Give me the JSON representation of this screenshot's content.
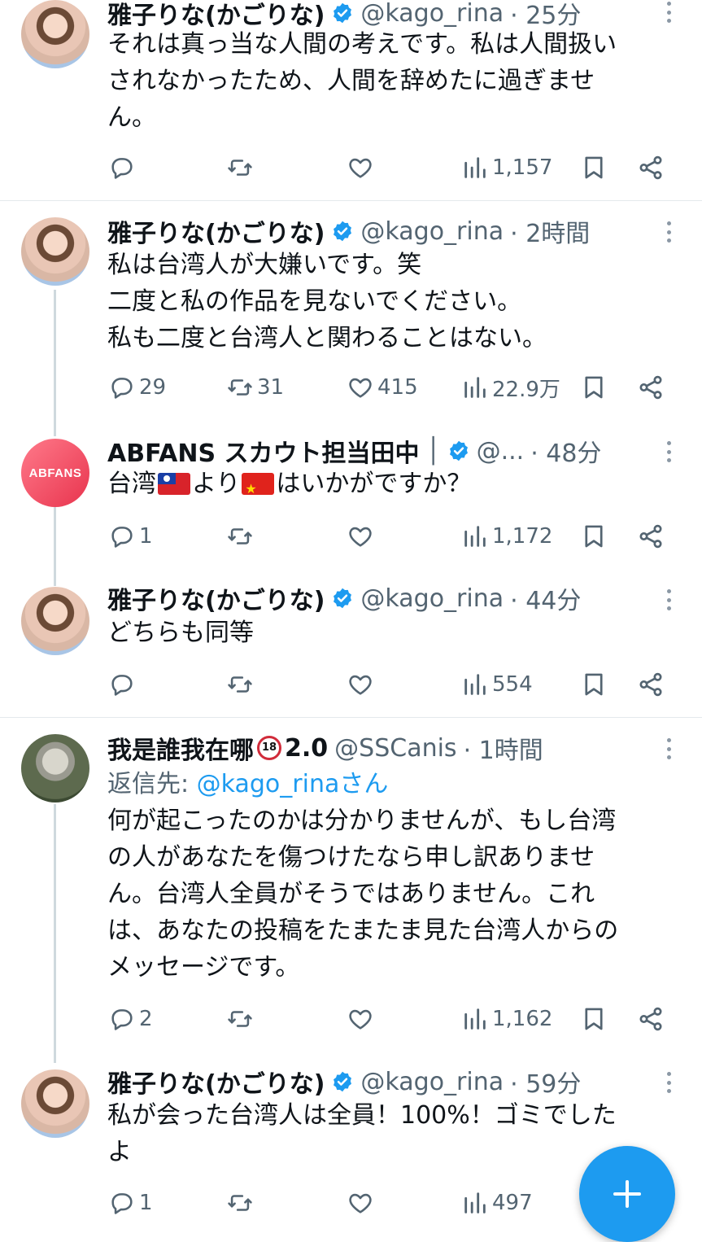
{
  "colors": {
    "accent": "#1d9bf0",
    "text": "#0f1419",
    "muted": "#536471",
    "divider": "#e4e9ec",
    "thread": "#cfd9de"
  },
  "tweets": [
    {
      "name": "雅子りな(かごりな)",
      "handle": "@kago_rina",
      "time": "· 25分",
      "lines": [
        "それは真っ当な人間の考えです。私は人間扱い",
        "されなかったため、人間を辞めたに過ぎませ",
        "ん。"
      ],
      "replies": "",
      "retweets": "",
      "likes": "",
      "views": "1,157"
    },
    {
      "name": "雅子りな(かごりな)",
      "handle": "@kago_rina",
      "time": "· 2時間",
      "lines": [
        "私は台湾人が大嫌いです。笑",
        "二度と私の作品を見ないでください。",
        "私も二度と台湾人と関わることはない。"
      ],
      "replies": "29",
      "retweets": "31",
      "likes": "415",
      "views": "22.9万"
    },
    {
      "name": "ABFANS スカウト担当田中",
      "name_suffix": "│",
      "handle": "@...",
      "time": "· 48分",
      "avatar_text": "ABFANS",
      "text_part1": "台湾",
      "text_part2": "より",
      "text_part3": "はいかがですか？",
      "replies": "1",
      "retweets": "",
      "likes": "",
      "views": "1,172"
    },
    {
      "name": "雅子りな(かごりな)",
      "handle": "@kago_rina",
      "time": "· 44分",
      "lines": [
        "どちらも同等"
      ],
      "replies": "",
      "retweets": "",
      "likes": "",
      "views": "554"
    },
    {
      "name": "我是誰我在哪",
      "badge": "18",
      "name_suffix": "2.0",
      "handle": "@SSCanis",
      "time": "· 1時間",
      "reply_label": "返信先: ",
      "reply_mention": "@kago_rinaさん",
      "lines": [
        "何が起こったのかは分かりませんが、もし台湾",
        "の人があなたを傷つけたなら申し訳ありませ",
        "ん。台湾人全員がそうではありません。これ",
        "は、あなたの投稿をたまたま見た台湾人からの",
        "メッセージです。"
      ],
      "replies": "2",
      "retweets": "",
      "likes": "",
      "views": "1,162"
    },
    {
      "name": "雅子りな(かごりな)",
      "handle": "@kago_rina",
      "time": "· 59分",
      "lines": [
        "私が会った台湾人は全員！100%！ゴミでした",
        "よ"
      ],
      "replies": "1",
      "retweets": "",
      "likes": "",
      "views": "497"
    }
  ],
  "icons": {
    "reply": "reply-icon",
    "retweet": "retweet-icon",
    "like": "heart-icon",
    "views": "views-icon",
    "bookmark": "bookmark-icon",
    "share": "share-icon",
    "fab": "plus-icon"
  }
}
